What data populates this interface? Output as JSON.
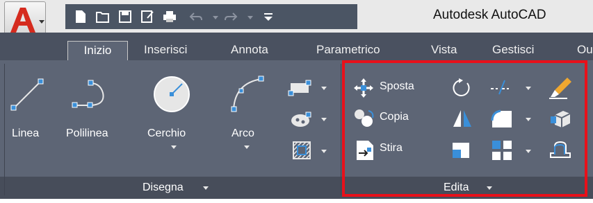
{
  "app": {
    "title": "Autodesk AutoCAD",
    "logo_letter": "A",
    "logo_color": "#d52b1e"
  },
  "quick_access": {
    "icons": [
      "new-icon",
      "open-icon",
      "save-icon",
      "save-as-icon",
      "plot-icon",
      "undo-icon",
      "redo-icon",
      "customize-icon"
    ]
  },
  "tabs": [
    {
      "label": "Inizio",
      "active": true
    },
    {
      "label": "Inserisci"
    },
    {
      "label": "Annota"
    },
    {
      "label": "Parametrico"
    },
    {
      "label": "Vista"
    },
    {
      "label": "Gestisci"
    },
    {
      "label": "Ou"
    }
  ],
  "panels": {
    "draw": {
      "title": "Disegna",
      "tools": [
        "Linea",
        "Polilinea",
        "Cerchio",
        "Arco"
      ]
    },
    "modify": {
      "title": "Edita",
      "tools": [
        "Sposta",
        "Copia",
        "Stira"
      ],
      "highlighted": true
    }
  },
  "colors": {
    "ribbon": "#5d6575",
    "tabbar": "#4a5160",
    "highlight": "#e8101a"
  }
}
